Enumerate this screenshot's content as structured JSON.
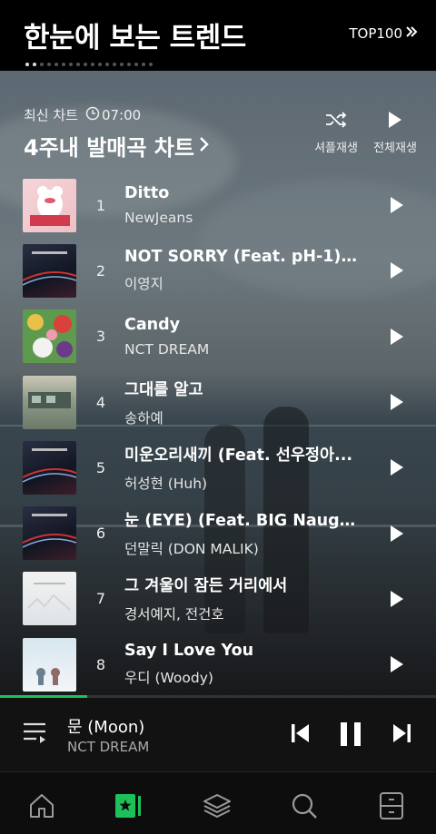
{
  "header": {
    "title": "한눈에 보는 트렌드",
    "top100_label": "TOP100"
  },
  "chart": {
    "latest_label": "최신 차트",
    "time": "07:00",
    "title": "4주내 발매곡 차트",
    "shuffle_label": "셔플재생",
    "play_all_label": "전체재생"
  },
  "songs": [
    {
      "rank": "1",
      "title": "Ditto",
      "artist": "NewJeans"
    },
    {
      "rank": "2",
      "title": "NOT SORRY (Feat. pH-1) (...",
      "artist": "이영지"
    },
    {
      "rank": "3",
      "title": "Candy",
      "artist": "NCT DREAM"
    },
    {
      "rank": "4",
      "title": "그대를 알고",
      "artist": "송하예"
    },
    {
      "rank": "5",
      "title": "미운오리새끼 (Feat. 선우정아...",
      "artist": "허성현 (Huh)"
    },
    {
      "rank": "6",
      "title": "눈 (EYE) (Feat. BIG Naughty...",
      "artist": "던말릭 (DON MALIK)"
    },
    {
      "rank": "7",
      "title": "그 겨울이 잠든 거리에서",
      "artist": "경서예지, 전건호"
    },
    {
      "rank": "8",
      "title": "Say I Love You",
      "artist": "우디 (Woody)"
    }
  ],
  "now_playing": {
    "title": "문 (Moon)",
    "artist": "NCT DREAM",
    "progress": 0.2
  },
  "nav": [
    "home-icon",
    "chart-icon",
    "layers-icon",
    "search-icon",
    "library-icon"
  ],
  "colors": {
    "accent": "#1ec05a"
  }
}
